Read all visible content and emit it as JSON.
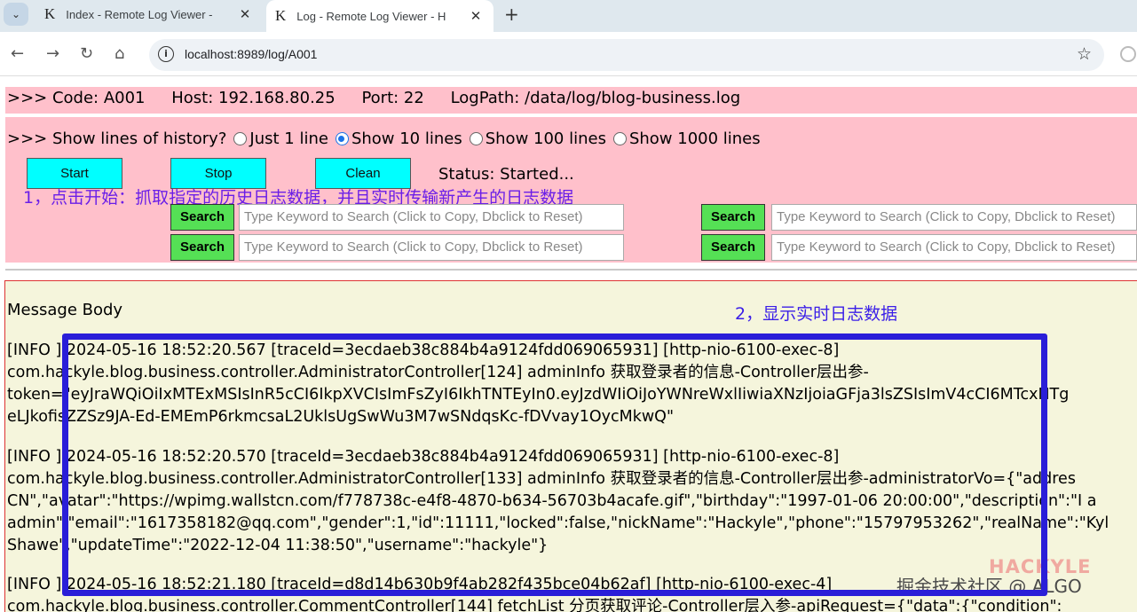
{
  "tabs": [
    {
      "favicon": "K",
      "title": "Index - Remote Log Viewer -",
      "close": "✕"
    },
    {
      "favicon": "K",
      "title": "Log - Remote Log Viewer - H",
      "close": "✕"
    }
  ],
  "new_tab": "+",
  "address": {
    "url": "localhost:8989/log/A001"
  },
  "info": {
    "code": ">>> Code: A001",
    "host": "Host: 192.168.80.25",
    "port": "Port: 22",
    "logpath": "LogPath: /data/log/blog-business.log"
  },
  "history": {
    "label": ">>> Show lines of history?",
    "options": [
      "Just 1 line",
      "Show 10 lines",
      "Show 100 lines",
      "Show 1000 lines"
    ],
    "selected": "Show 10 lines"
  },
  "controls": {
    "start": "Start",
    "stop": "Stop",
    "clean": "Clean",
    "status": "Status: Started..."
  },
  "annotation1": "1，点击开始：抓取指定的历史日志数据，并且实时传输新产生的日志数据",
  "search": {
    "button": "Search",
    "placeholder": "Type Keyword to Search (Click to Copy, Dbclick to Reset)"
  },
  "message": {
    "title": "Message Body",
    "annotation2": "2，显示实时日志数据",
    "lines": [
      "[INFO ] 2024-05-16 18:52:20.567 [traceId=3ecdaeb38c884b4a9124fdd069065931] [http-nio-6100-exec-8]",
      "com.hackyle.blog.business.controller.AdministratorController[124] adminInfo 获取登录者的信息-Controller层出参-",
      "token=\"eyJraWQiOiIxMTExMSIsInR5cCI6IkpXVCIsImFsZyI6IkhTNTEyIn0.eyJzdWIiOiJoYWNreWxlIiwiaXNzIjoiaGFja3lsZSIsImV4cCI6MTcxNTg",
      "eLJkofisZZSz9JA-Ed-EMEmP6rkmcsaL2UklsUgSwWu3M7wSNdqsKc-fDVvay1OycMkwQ\"",
      "[INFO ] 2024-05-16 18:52:20.570 [traceId=3ecdaeb38c884b4a9124fdd069065931] [http-nio-6100-exec-8]",
      "com.hackyle.blog.business.controller.AdministratorController[133] adminInfo 获取登录者的信息-Controller层出参-administratorVo={\"addres",
      "CN\",\"avatar\":\"https://wpimg.wallstcn.com/f778738c-e4f8-4870-b634-56703b4acafe.gif\",\"birthday\":\"1997-01-06 20:00:00\",\"description\":\"I a",
      "admin\",\"email\":\"1617358182@qq.com\",\"gender\":1,\"id\":11111,\"locked\":false,\"nickName\":\"Hackyle\",\"phone\":\"15797953262\",\"realName\":\"Kyl",
      "Shawe\",\"updateTime\":\"2022-12-04 11:38:50\",\"username\":\"hackyle\"}",
      "[INFO ] 2024-05-16 18:52:21.180 [traceId=d8d14b630b9f4ab282f435bce04b62af] [http-nio-6100-exec-4]",
      "com.hackyle.blog.business.controller.CommentController[144] fetchList 分页获取评论-Controller层入参-apiRequest={\"data\":{\"condition\":"
    ]
  },
  "watermark": {
    "brand": "HACKYLE",
    "site": "掘金技术社区 @ ALGO"
  },
  "colors": {
    "accent_bg": "#ffc0cb",
    "control_button": "#00ffff",
    "search_button": "#55e055",
    "message_bg": "#f5f5dc",
    "annotation": "#3a1ee8"
  }
}
